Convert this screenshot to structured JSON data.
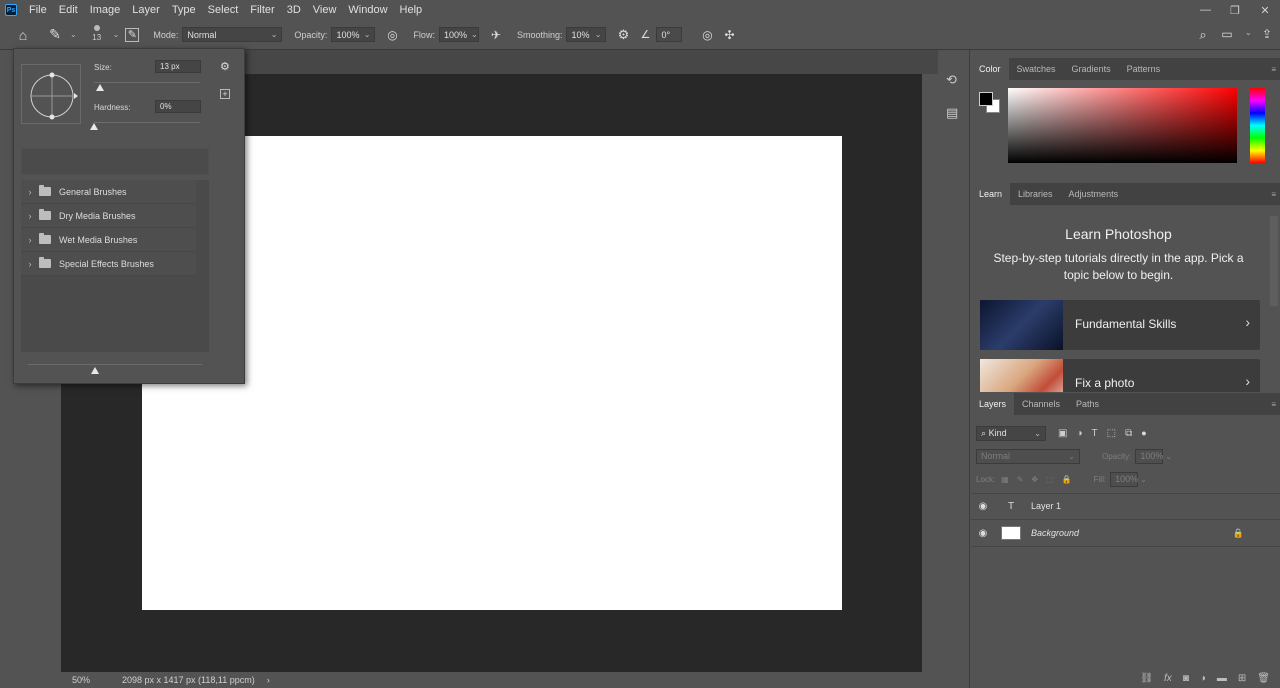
{
  "app": {
    "logo": "Ps"
  },
  "menu": [
    "File",
    "Edit",
    "Image",
    "Layer",
    "Type",
    "Select",
    "Filter",
    "3D",
    "View",
    "Window",
    "Help"
  ],
  "window_controls": {
    "minimize": "—",
    "restore": "❐",
    "close": "✕"
  },
  "options_bar": {
    "brush_size_small": "13",
    "mode_label": "Mode:",
    "mode_value": "Normal",
    "opacity_label": "Opacity:",
    "opacity_value": "100%",
    "flow_label": "Flow:",
    "flow_value": "100%",
    "smoothing_label": "Smoothing:",
    "smoothing_value": "10%",
    "angle_value": "0°"
  },
  "brush_popup": {
    "size_label": "Size:",
    "size_value": "13 px",
    "hardness_label": "Hardness:",
    "hardness_value": "0%",
    "size_slider_level": 0.06,
    "hardness_slider_level": 0.0,
    "folders": [
      "General Brushes",
      "Dry Media Brushes",
      "Wet Media Brushes",
      "Special Effects Brushes"
    ]
  },
  "status": {
    "zoom": "50%",
    "doc_info": "2098 px x 1417 px (118,11 ppcm)",
    "arrow": "›"
  },
  "color_panel": {
    "tabs": [
      "Color",
      "Swatches",
      "Gradients",
      "Patterns"
    ],
    "active_tab": 0,
    "foreground": "#000000",
    "background": "#ffffff",
    "hue": "#ff0000"
  },
  "learn_panel": {
    "tabs": [
      "Learn",
      "Libraries",
      "Adjustments"
    ],
    "title": "Learn Photoshop",
    "description": "Step-by-step tutorials directly in the app. Pick a topic below to begin.",
    "cards": [
      "Fundamental Skills",
      "Fix a photo"
    ]
  },
  "layers_panel": {
    "tabs": [
      "Layers",
      "Channels",
      "Paths"
    ],
    "filter_kind": "Kind",
    "blend_mode": "Normal",
    "opacity_label": "Opacity:",
    "opacity_value": "100%",
    "lock_label": "Lock:",
    "fill_label": "Fill:",
    "fill_value": "100%",
    "layers": [
      {
        "name": "Layer 1",
        "type": "text"
      },
      {
        "name": "Background",
        "type": "image"
      }
    ]
  }
}
